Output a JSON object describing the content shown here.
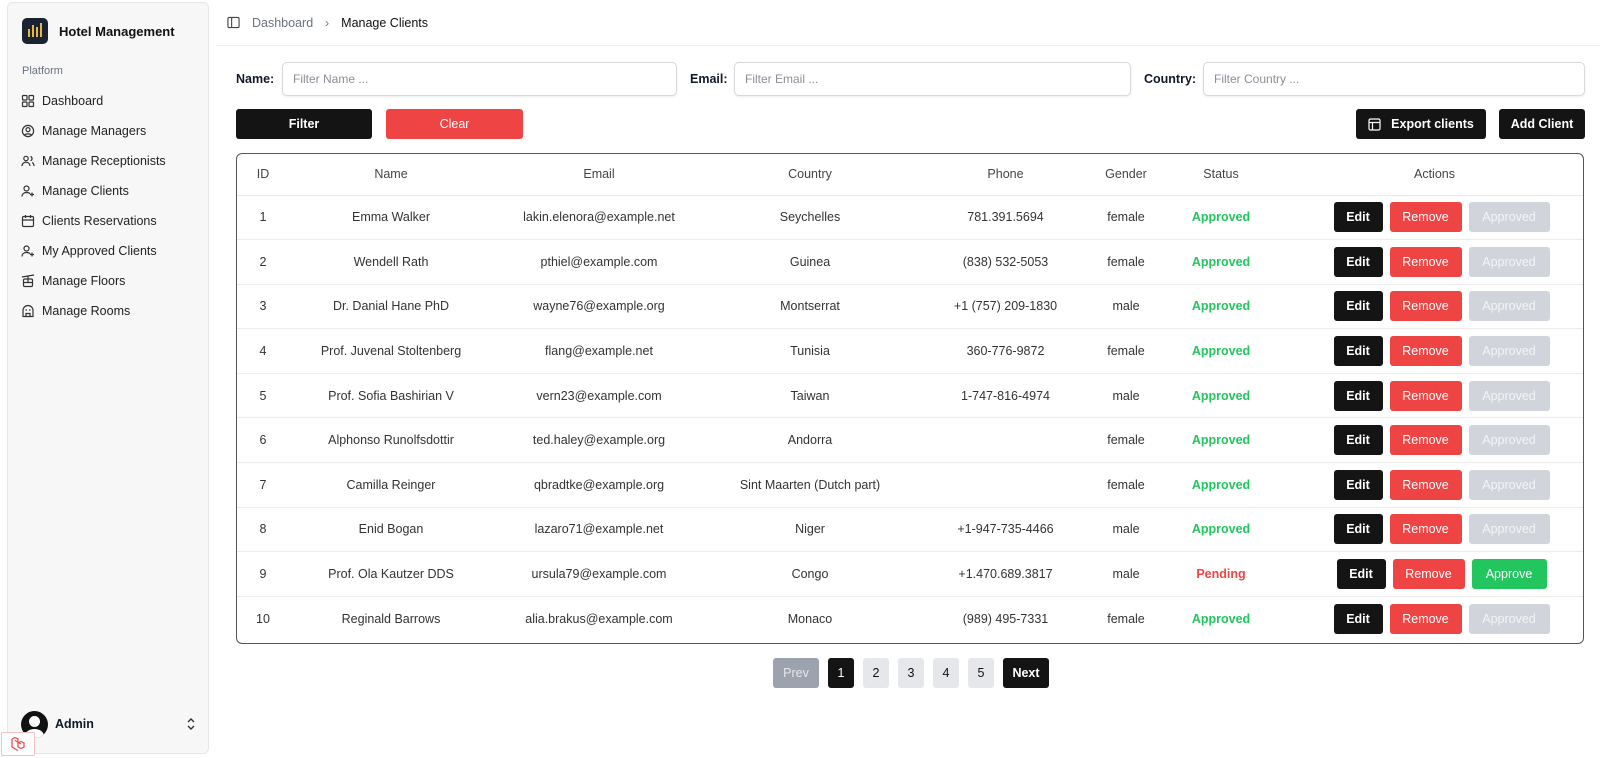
{
  "brand": {
    "name": "Hotel Management"
  },
  "sidebar": {
    "section_label": "Platform",
    "items": [
      {
        "label": "Dashboard",
        "icon": "dashboard-grid-icon"
      },
      {
        "label": "Manage Managers",
        "icon": "user-circle-icon"
      },
      {
        "label": "Manage Receptionists",
        "icon": "users-icon"
      },
      {
        "label": "Manage Clients",
        "icon": "user-plus-icon"
      },
      {
        "label": "Clients Reservations",
        "icon": "calendar-icon"
      },
      {
        "label": "My Approved Clients",
        "icon": "user-plus-icon"
      },
      {
        "label": "Manage Floors",
        "icon": "cable-car-icon"
      },
      {
        "label": "Manage Rooms",
        "icon": "building-icon"
      }
    ],
    "user": {
      "name": "Admin"
    }
  },
  "breadcrumb": {
    "parent": "Dashboard",
    "current": "Manage Clients"
  },
  "filters": {
    "name": {
      "label": "Name:",
      "placeholder": "Filter Name ...",
      "value": ""
    },
    "email": {
      "label": "Email:",
      "placeholder": "Filter Email ...",
      "value": ""
    },
    "country": {
      "label": "Country:",
      "placeholder": "Filter Country ...",
      "value": ""
    }
  },
  "toolbar": {
    "filter_label": "Filter",
    "clear_label": "Clear",
    "export_label": "Export clients",
    "add_label": "Add Client"
  },
  "table": {
    "columns": [
      "ID",
      "Name",
      "Email",
      "Country",
      "Phone",
      "Gender",
      "Status",
      "Actions"
    ],
    "rows": [
      {
        "id": "1",
        "name": "Emma Walker",
        "email": "lakin.elenora@example.net",
        "country": "Seychelles",
        "phone": "781.391.5694",
        "gender": "female",
        "status": "Approved",
        "approve_label": "Approved"
      },
      {
        "id": "2",
        "name": "Wendell Rath",
        "email": "pthiel@example.com",
        "country": "Guinea",
        "phone": "(838) 532-5053",
        "gender": "female",
        "status": "Approved",
        "approve_label": "Approved"
      },
      {
        "id": "3",
        "name": "Dr. Danial Hane PhD",
        "email": "wayne76@example.org",
        "country": "Montserrat",
        "phone": "+1 (757) 209-1830",
        "gender": "male",
        "status": "Approved",
        "approve_label": "Approved"
      },
      {
        "id": "4",
        "name": "Prof. Juvenal Stoltenberg",
        "email": "flang@example.net",
        "country": "Tunisia",
        "phone": "360-776-9872",
        "gender": "female",
        "status": "Approved",
        "approve_label": "Approved"
      },
      {
        "id": "5",
        "name": "Prof. Sofia Bashirian V",
        "email": "vern23@example.com",
        "country": "Taiwan",
        "phone": "1-747-816-4974",
        "gender": "male",
        "status": "Approved",
        "approve_label": "Approved"
      },
      {
        "id": "6",
        "name": "Alphonso Runolfsdottir",
        "email": "ted.haley@example.org",
        "country": "Andorra",
        "phone": "",
        "gender": "female",
        "status": "Approved",
        "approve_label": "Approved"
      },
      {
        "id": "7",
        "name": "Camilla Reinger",
        "email": "qbradtke@example.org",
        "country": "Sint Maarten (Dutch part)",
        "phone": "",
        "gender": "female",
        "status": "Approved",
        "approve_label": "Approved"
      },
      {
        "id": "8",
        "name": "Enid Bogan",
        "email": "lazaro71@example.net",
        "country": "Niger",
        "phone": "+1-947-735-4466",
        "gender": "male",
        "status": "Approved",
        "approve_label": "Approved"
      },
      {
        "id": "9",
        "name": "Prof. Ola Kautzer DDS",
        "email": "ursula79@example.com",
        "country": "Congo",
        "phone": "+1.470.689.3817",
        "gender": "male",
        "status": "Pending",
        "approve_label": "Approve"
      },
      {
        "id": "10",
        "name": "Reginald Barrows",
        "email": "alia.brakus@example.com",
        "country": "Monaco",
        "phone": "(989) 495-7331",
        "gender": "female",
        "status": "Approved",
        "approve_label": "Approved"
      }
    ],
    "action_labels": {
      "edit": "Edit",
      "remove": "Remove"
    }
  },
  "pagination": {
    "prev": "Prev",
    "pages": [
      "1",
      "2",
      "3",
      "4",
      "5"
    ],
    "current": "1",
    "next": "Next"
  },
  "colors": {
    "primary_dark": "#141414",
    "danger": "#ef4444",
    "success": "#22c55e",
    "disabled": "#d1d5db"
  }
}
